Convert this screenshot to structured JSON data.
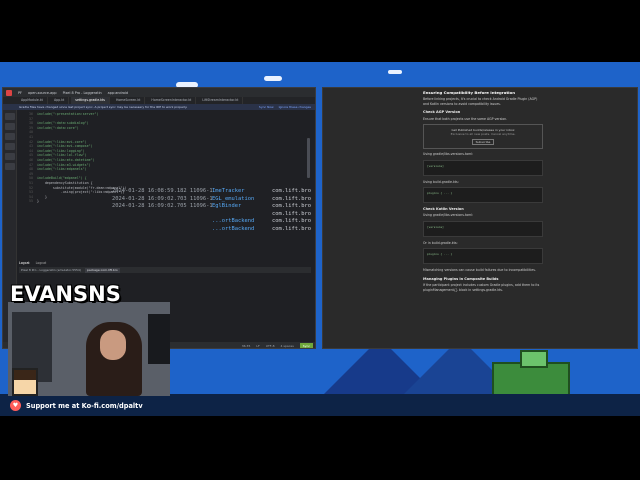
{
  "streamer": {
    "name": "EVANSNS"
  },
  "kofi": {
    "text": "Support me at Ko-fi.com/dpaltv",
    "icon": "heart-cup-icon"
  },
  "ide": {
    "title_items": [
      "PF",
      "open-source-app",
      "Pixel 8 Pro - Loggeratin",
      "app:android"
    ],
    "tabs": [
      "AppModule.kt",
      "App.kt",
      "settings.gradle.kts",
      "HomeScreen.kt",
      "HomeScreenInteractor.kt",
      "LiftStreamInteractor.kt"
    ],
    "banner": "Gradle files have changed since last project sync. A project sync may be necessary for the IDE to work properly.",
    "banner_actions": [
      "Sync Now",
      "Ignore these changes"
    ],
    "code_lines": [
      {
        "n": "36",
        "text": "include(\":presentation:server\")"
      },
      {
        "n": "37",
        "text": ""
      },
      {
        "n": "38",
        "text": "include(\":data:subdialog\")"
      },
      {
        "n": "39",
        "text": "include(\":data:core\")"
      },
      {
        "n": "40",
        "text": ""
      },
      {
        "n": "41",
        "text": ""
      },
      {
        "n": "42",
        "text": "include(\":libs:mvi-core\")"
      },
      {
        "n": "43",
        "text": "include(\":libs:mvi-compose\")"
      },
      {
        "n": "44",
        "text": "include(\":libs:logging\")"
      },
      {
        "n": "45",
        "text": "include(\":libs:lol-flow\")"
      },
      {
        "n": "46",
        "text": "include(\":libs:mtx-datetime\")"
      },
      {
        "n": "47",
        "text": "include(\":libs:m3-widgets\")"
      },
      {
        "n": "48",
        "text": "include(\":libs:mdpanels\")"
      },
      {
        "n": "49",
        "text": ""
      },
      {
        "n": "50",
        "text": "includeBuild(\"mdpanel\") {"
      },
      {
        "n": "51",
        "text": "    dependencySubstitution {"
      },
      {
        "n": "52",
        "text": "        substitute(module(\"fr.dean:mdpanel\"))"
      },
      {
        "n": "53",
        "text": "            .using(project(\":libs:mdpanel\"))"
      },
      {
        "n": "54",
        "text": "    }"
      },
      {
        "n": "55",
        "text": "}"
      }
    ],
    "bottom_tabs": [
      "Logcat",
      "Logcat"
    ],
    "logcat_device": "Pixel 8 Pro - Loggeratin (emulator-5554)",
    "logcat_filter": "package:com.lift.bro",
    "log_rows": [
      {
        "ts": "2024-01-28 16:08:59.182 11096-11096",
        "tag": "ImeTracker",
        "pkg": "com.lift.bro"
      },
      {
        "ts": "2024-01-28 16:09:02.703 11096-11983",
        "tag": "EGL_emulation",
        "pkg": "com.lift.bro"
      },
      {
        "ts": "2024-01-28 16:09:02.705 11096-11983",
        "tag": "EglBinder",
        "pkg": "com.lift.bro"
      },
      {
        "ts": "",
        "tag": "",
        "pkg": "com.lift.bro"
      },
      {
        "ts": "",
        "tag": "...ortBackend",
        "pkg": "com.lift.bro"
      },
      {
        "ts": "",
        "tag": "...ortBackend",
        "pkg": "com.lift.bro"
      }
    ],
    "status": {
      "pos": "36:35",
      "eol": "LF",
      "enc": "UTF-8",
      "indent": "4 spaces",
      "pill": "Sync"
    }
  },
  "browser": {
    "heading": "Ensuring Compatibility Before Integration",
    "intro": "Before linking projects, it's crucial to check Android Gradle Plugin (AGP) and Kotlin versions to avoid compatibility issues.",
    "agp_heading": "Check AGP Version",
    "agp_text": "Ensure that both projects use the same AGP version.",
    "infobox_text": "Get Published builds/release in your inbox",
    "infobox_sub": "Exclusive to all new posts. Cancel anytime.",
    "infobox_btn": "Subscribe",
    "p_groovy": "Using gradle/libs.versions.toml:",
    "p_build": "Using build.gradle.kts:",
    "kotlin_heading": "Check Kotlin Version",
    "p_kotlin": "Using gradle/libs.versions.toml:",
    "p_kotlin2": "Or in build.gradle.kts:",
    "p_mismatch": "Mismatching versions can cause build failures due to incompatibilities.",
    "managing_heading": "Managing Plugins in Composite Builds",
    "managing_text": "If the participant project includes custom Gradle plugins, add them to its pluginManagement{} block in settings.gradle.kts."
  }
}
